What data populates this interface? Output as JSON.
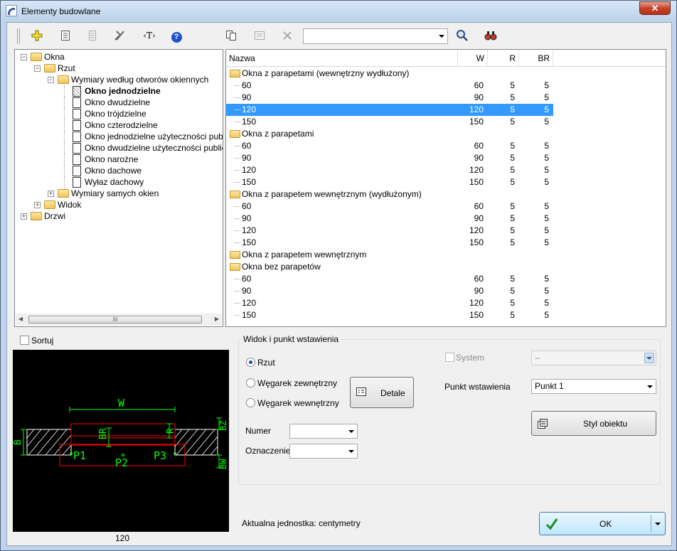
{
  "window": {
    "title": "Elementy budowlane",
    "close_glyph": "✕"
  },
  "toolbar": {
    "text_tool_label": "‹T›",
    "help_glyph": "?",
    "search_value": ""
  },
  "tree": {
    "nodes": [
      {
        "label": "Okna",
        "level": 0,
        "expander": "−",
        "kind": "folder"
      },
      {
        "label": "Rzut",
        "level": 1,
        "expander": "−",
        "kind": "folder"
      },
      {
        "label": "Wymiary według otworów okiennych",
        "level": 2,
        "expander": "−",
        "kind": "folder"
      },
      {
        "label": "Okno jednodzielne",
        "level": 3,
        "kind": "doc",
        "bold": true
      },
      {
        "label": "Okno dwudzielne",
        "level": 3,
        "kind": "doc"
      },
      {
        "label": "Okno trójdzielne",
        "level": 3,
        "kind": "doc"
      },
      {
        "label": "Okno czterodzielne",
        "level": 3,
        "kind": "doc"
      },
      {
        "label": "Okno jednodzielne użyteczności publiczn",
        "level": 3,
        "kind": "doc"
      },
      {
        "label": "Okno dwudzielne użyteczności publiczne",
        "level": 3,
        "kind": "doc"
      },
      {
        "label": "Okno narożne",
        "level": 3,
        "kind": "doc"
      },
      {
        "label": "Okno dachowe",
        "level": 3,
        "kind": "doc"
      },
      {
        "label": "Wyłaz dachowy",
        "level": 3,
        "kind": "doc"
      },
      {
        "label": "Wymiary samych okien",
        "level": 2,
        "expander": "+",
        "kind": "folder"
      },
      {
        "label": "Widok",
        "level": 1,
        "expander": "+",
        "kind": "folder"
      },
      {
        "label": "Drzwi",
        "level": 0,
        "expander": "+",
        "kind": "folder"
      }
    ],
    "scroll_grip": "III"
  },
  "list": {
    "columns": [
      "Nazwa",
      "W",
      "R",
      "BR"
    ],
    "rows": [
      {
        "group": "Okna z parapetami (wewnętrzny wydłużony)"
      },
      {
        "name": "60",
        "w": "60",
        "r": "5",
        "br": "5"
      },
      {
        "name": "90",
        "w": "90",
        "r": "5",
        "br": "5"
      },
      {
        "name": "120",
        "w": "120",
        "r": "5",
        "br": "5",
        "selected": true
      },
      {
        "name": "150",
        "w": "150",
        "r": "5",
        "br": "5"
      },
      {
        "group": "Okna z parapetami"
      },
      {
        "name": "60",
        "w": "60",
        "r": "5",
        "br": "5"
      },
      {
        "name": "90",
        "w": "90",
        "r": "5",
        "br": "5"
      },
      {
        "name": "120",
        "w": "120",
        "r": "5",
        "br": "5"
      },
      {
        "name": "150",
        "w": "150",
        "r": "5",
        "br": "5"
      },
      {
        "group": "Okna z parapetem wewnętrznym (wydłużonym)"
      },
      {
        "name": "60",
        "w": "60",
        "r": "5",
        "br": "5"
      },
      {
        "name": "90",
        "w": "90",
        "r": "5",
        "br": "5"
      },
      {
        "name": "120",
        "w": "120",
        "r": "5",
        "br": "5"
      },
      {
        "name": "150",
        "w": "150",
        "r": "5",
        "br": "5"
      },
      {
        "group": "Okna z parapetem wewnętrznym"
      },
      {
        "group": "Okna bez parapetów"
      },
      {
        "name": "60",
        "w": "60",
        "r": "5",
        "br": "5"
      },
      {
        "name": "90",
        "w": "90",
        "r": "5",
        "br": "5"
      },
      {
        "name": "120",
        "w": "120",
        "r": "5",
        "br": "5"
      },
      {
        "name": "150",
        "w": "150",
        "r": "5",
        "br": "5"
      }
    ]
  },
  "sort": {
    "label": "Sortuj",
    "checked": false
  },
  "preview": {
    "caption": "120",
    "labels": {
      "w": "W",
      "br": "BR",
      "r": "R",
      "b": "B",
      "bz": "BZ",
      "bw": "BW",
      "p1": "P1",
      "p2": "P2",
      "p3": "P3"
    }
  },
  "group": {
    "title": "Widok i punkt wstawienia",
    "radio_rzut": "Rzut",
    "radio_zew": "Węgarek zewnętrzny",
    "radio_wew": "Węgarek wewnętrzny",
    "details_button": "Detale",
    "system_label": "System",
    "system_value": "--",
    "insert_point_label": "Punkt wstawienia",
    "insert_point_value": "Punkt 1",
    "object_style_button": "Styl obiektu",
    "numer_label": "Numer",
    "numer_value": "",
    "oznaczenie_label": "Oznaczenie",
    "oznaczenie_value": ""
  },
  "footer": {
    "unit_text": "Aktualna jednostka: centymetry",
    "ok_label": "OK"
  },
  "colors": {
    "selection": "#3399ff",
    "preview_bg": "#000000",
    "cad_green": "#00ff00",
    "cad_red": "#ff0000",
    "cad_white": "#ffffff"
  }
}
